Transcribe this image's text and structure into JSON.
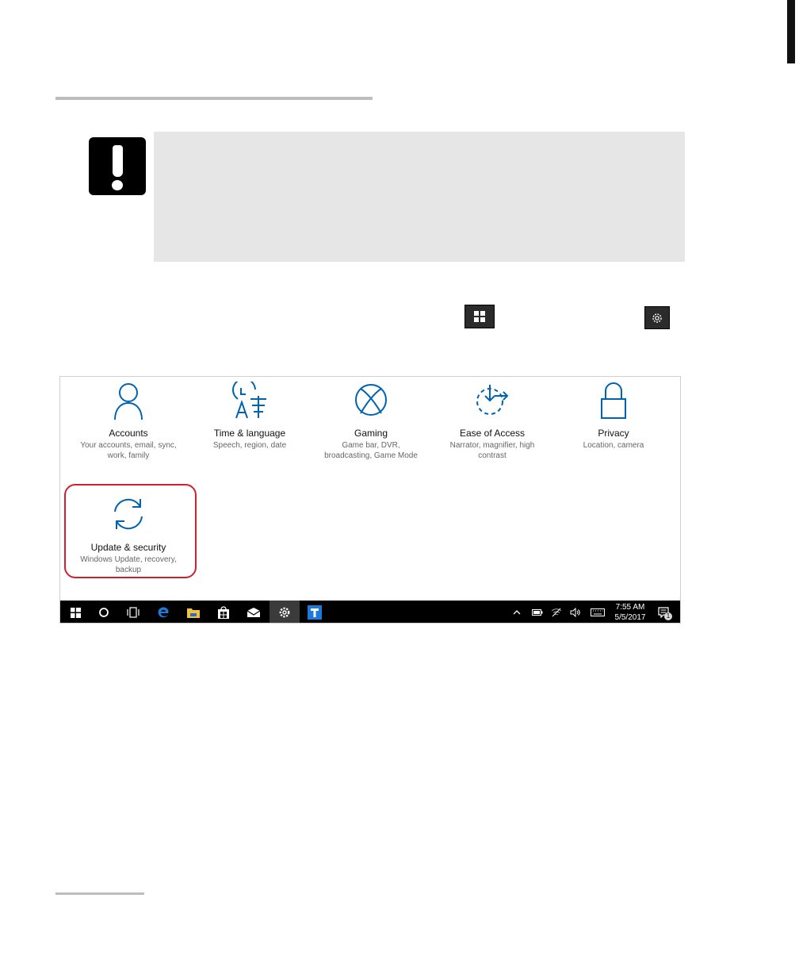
{
  "settings": {
    "tiles": [
      {
        "title": "Accounts",
        "desc": [
          "Your accounts, email, sync,",
          "work, family"
        ],
        "icon": "person-icon"
      },
      {
        "title": "Time & language",
        "desc": [
          "Speech, region, date"
        ],
        "icon": "time-language-icon"
      },
      {
        "title": "Gaming",
        "desc": [
          "Game bar, DVR,",
          "broadcasting, Game Mode"
        ],
        "icon": "xbox-icon"
      },
      {
        "title": "Ease of Access",
        "desc": [
          "Narrator, magnifier, high",
          "contrast"
        ],
        "icon": "ease-of-access-icon"
      },
      {
        "title": "Privacy",
        "desc": [
          "Location, camera"
        ],
        "icon": "lock-icon"
      },
      {
        "title": "Update & security",
        "desc": [
          "Windows Update, recovery,",
          "backup"
        ],
        "icon": "sync-icon"
      }
    ],
    "accent": "#0063b1",
    "highlight_color": "#d01f2e"
  },
  "taskbar": {
    "time": "7:55 AM",
    "date": "5/5/2017",
    "notification_count": "1"
  }
}
